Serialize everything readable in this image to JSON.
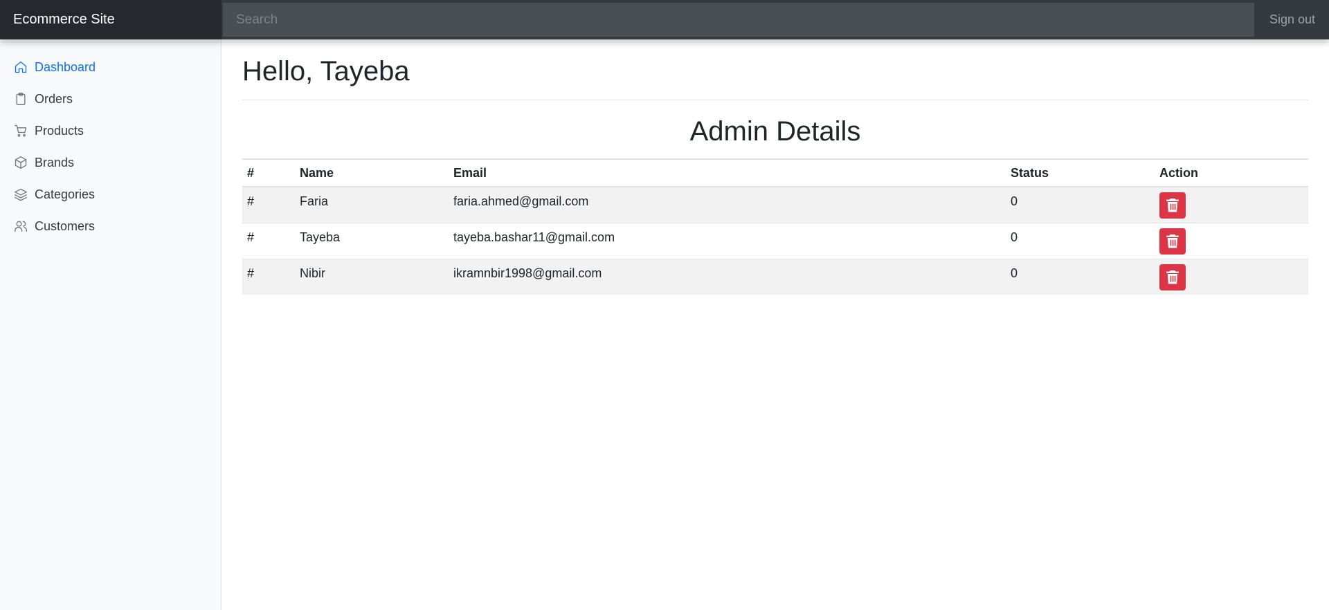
{
  "navbar": {
    "brand": "Ecommerce Site",
    "search_placeholder": "Search",
    "signout_label": "Sign out"
  },
  "sidebar": {
    "items": [
      {
        "label": "Dashboard",
        "icon": "home-icon",
        "active": true
      },
      {
        "label": "Orders",
        "icon": "clipboard-icon",
        "active": false
      },
      {
        "label": "Products",
        "icon": "cart-icon",
        "active": false
      },
      {
        "label": "Brands",
        "icon": "box-icon",
        "active": false
      },
      {
        "label": "Categories",
        "icon": "layers-icon",
        "active": false
      },
      {
        "label": "Customers",
        "icon": "users-icon",
        "active": false
      }
    ]
  },
  "main": {
    "greeting": "Hello, Tayeba",
    "section_title": "Admin Details",
    "table": {
      "headers": [
        "#",
        "Name",
        "Email",
        "Status",
        "Action"
      ],
      "rows": [
        {
          "index": "#",
          "name": "Faria",
          "email": "faria.ahmed@gmail.com",
          "status": "0"
        },
        {
          "index": "#",
          "name": "Tayeba",
          "email": "tayeba.bashar11@gmail.com",
          "status": "0"
        },
        {
          "index": "#",
          "name": "Nibir",
          "email": "ikramnbir1998@gmail.com",
          "status": "0"
        }
      ],
      "action_icon": "trash-icon"
    }
  },
  "colors": {
    "navbar": "#343a40",
    "brand_bg": "#25292d",
    "active_link": "#0d6efd",
    "delete_button": "#dc3545",
    "striped_row": "#f2f2f2"
  }
}
